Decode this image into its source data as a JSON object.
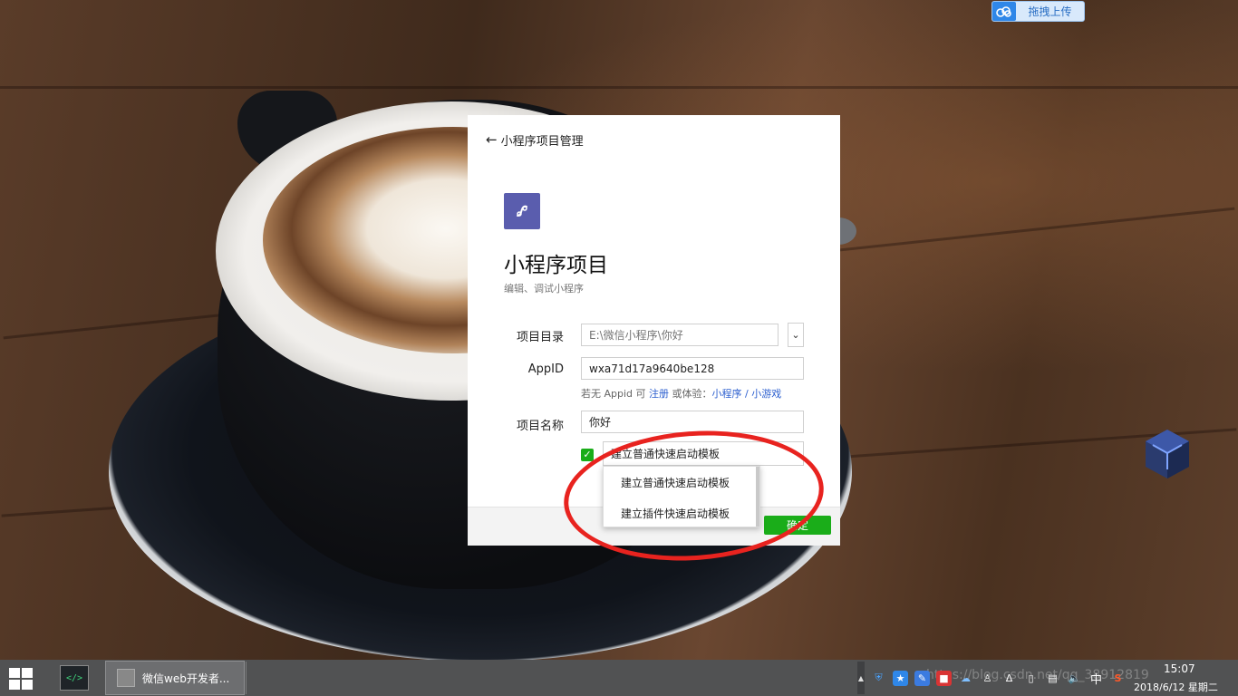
{
  "upload_pill": {
    "label": "拖拽上传",
    "icon": "cloud-upload-icon"
  },
  "dialog": {
    "back_label": "小程序项目管理",
    "title": "小程序项目",
    "subtitle": "编辑、调试小程序",
    "fields": {
      "directory": {
        "label": "项目目录",
        "placeholder": "E:\\微信小程序\\你好"
      },
      "appid": {
        "label": "AppID",
        "value": "wxa71d17a9640be128"
      },
      "name": {
        "label": "项目名称",
        "value": "你好"
      }
    },
    "hint": {
      "prefix": "若无 Appid 可 ",
      "register": "注册",
      "middle": " 或体验：",
      "miniprogram": "小程序",
      "slash": " / ",
      "minigame": "小游戏"
    },
    "template": {
      "checked": true,
      "selected": "建立普通快速启动模板",
      "options": [
        "建立普通快速启动模板",
        "建立插件快速启动模板"
      ]
    },
    "confirm_label": "确定",
    "accent_color": "#1aad19",
    "logo_color": "#5a5dae"
  },
  "annotation_color": "#e8231f",
  "taskbar": {
    "window_title": "微信web开发者...",
    "devtools_icon_text": "</>",
    "tray": {
      "input_method": "中",
      "watermark": "https://blog.csdn.net/qq_38912819"
    },
    "clock": {
      "time": "15:07",
      "date": "2018/6/12 星期二"
    }
  }
}
